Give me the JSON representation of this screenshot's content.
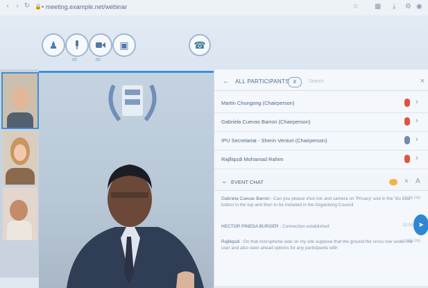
{
  "browser": {
    "url": "• meeting.example.net/webinar"
  },
  "toolbar": {
    "tool_sub_1": "00",
    "tool_sub_2": "00"
  },
  "participants_panel": {
    "title": "ALL PARTICIPANTS",
    "count": "8",
    "search_placeholder": "Search",
    "rows": [
      {
        "name": "Martin Chungong (Chairperson)",
        "mic_color": "#e0533e"
      },
      {
        "name": "Gabriela Cuevas Barron (Chairperson)",
        "mic_color": "#e0533e"
      },
      {
        "name": "IPU Secretariat - Sherin Venturi (Chairperson)",
        "mic_color": "#6f8bb0"
      },
      {
        "name": "Rajlliqudi Mohamad Rahim",
        "mic_color": "#e0533e"
      }
    ]
  },
  "chat": {
    "title": "EVENT CHAT",
    "messages": [
      {
        "author": "Gabriela Cuevas Barron",
        "text": " : Can you please shut mic and camera on 'Privacy' and in the 'Go Live' button in the top and then to be included in the Organising Council",
        "time": "12:03 PM"
      },
      {
        "author": "HECTOR PINEDA BURGER",
        "text": " : Connection established",
        "time": "12:04 PM"
      },
      {
        "author": "Rajlliqudi",
        "text": " : On that microphone side on my site suppose that the ground the cross row under the user and also seen ahead options for any participants with",
        "time": "12:05 PM"
      }
    ]
  },
  "colors": {
    "accent": "#3d8fd6",
    "muted_mic": "#e0533e",
    "chat_badge": "#f2b24a"
  }
}
